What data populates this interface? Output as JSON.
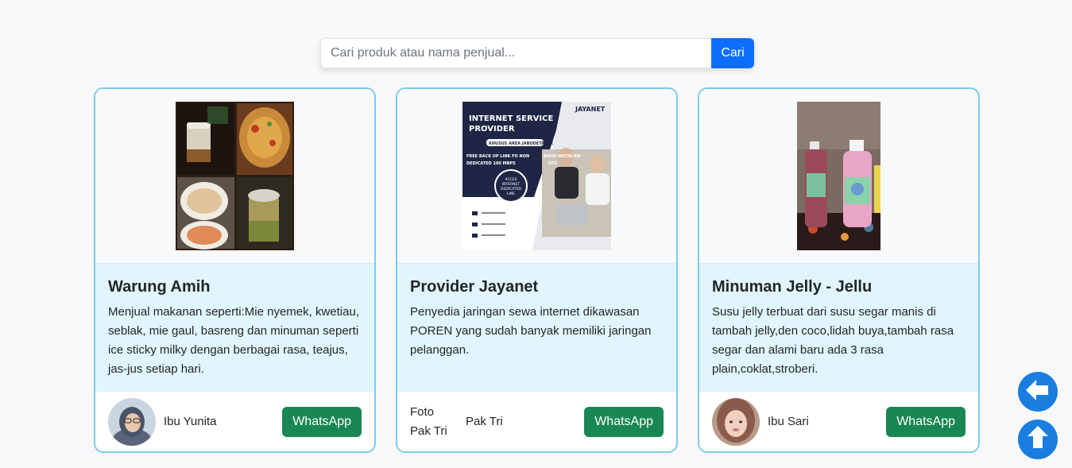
{
  "search": {
    "placeholder": "Cari produk atau nama penjual...",
    "value": "",
    "button_label": "Cari"
  },
  "cards": [
    {
      "title": "Warung Amih",
      "description": "Menjual makanan seperti:Mie nyemek, kwetiau, seblak, mie gaul, basreng dan minuman seperti ice sticky milky dengan berbagai rasa, teajus, jas-jus setiap hari.",
      "seller": "Ibu Yunita",
      "button": "WhatsApp"
    },
    {
      "title": "Provider Jayanet",
      "description": "Penyedia jaringan sewa internet dikawasan POREN yang sudah banyak memiliki jaringan pelanggan.",
      "seller": "Pak Tri",
      "avatar_alt": "Foto Pak Tri",
      "button": "WhatsApp",
      "banner": {
        "brand": "JAYANET",
        "line1": "INTERNET SERVICE",
        "line2": "PROVIDER",
        "area": "KHUSUS AREA JABODETABEK",
        "promo1": "FREE BACK UP LINK FO NON",
        "promo2": "DEDICATED 100 MBPS",
        "install1": "BIAYA INSTALASI",
        "install2": "OTC",
        "circle1": "ACCES",
        "circle2": "INTERNET",
        "circle3": "DEDICATED",
        "circle4": "LINE"
      }
    },
    {
      "title": "Minuman Jelly - Jellu",
      "description": "Susu jelly terbuat dari susu segar manis di tambah jelly,den coco,lidah buya,tambah rasa segar dan alami baru ada 3 rasa plain,coklat,stroberi.",
      "seller": "Ibu Sari",
      "button": "WhatsApp"
    }
  ],
  "fab": {
    "back_icon": "arrow-left-icon",
    "top_icon": "arrow-up-icon",
    "color": "#1a7de0"
  },
  "colors": {
    "primary": "#0d6efd",
    "whatsapp": "#198754",
    "card_border": "#7fcbe8",
    "card_body_bg": "#e1f5fd"
  }
}
